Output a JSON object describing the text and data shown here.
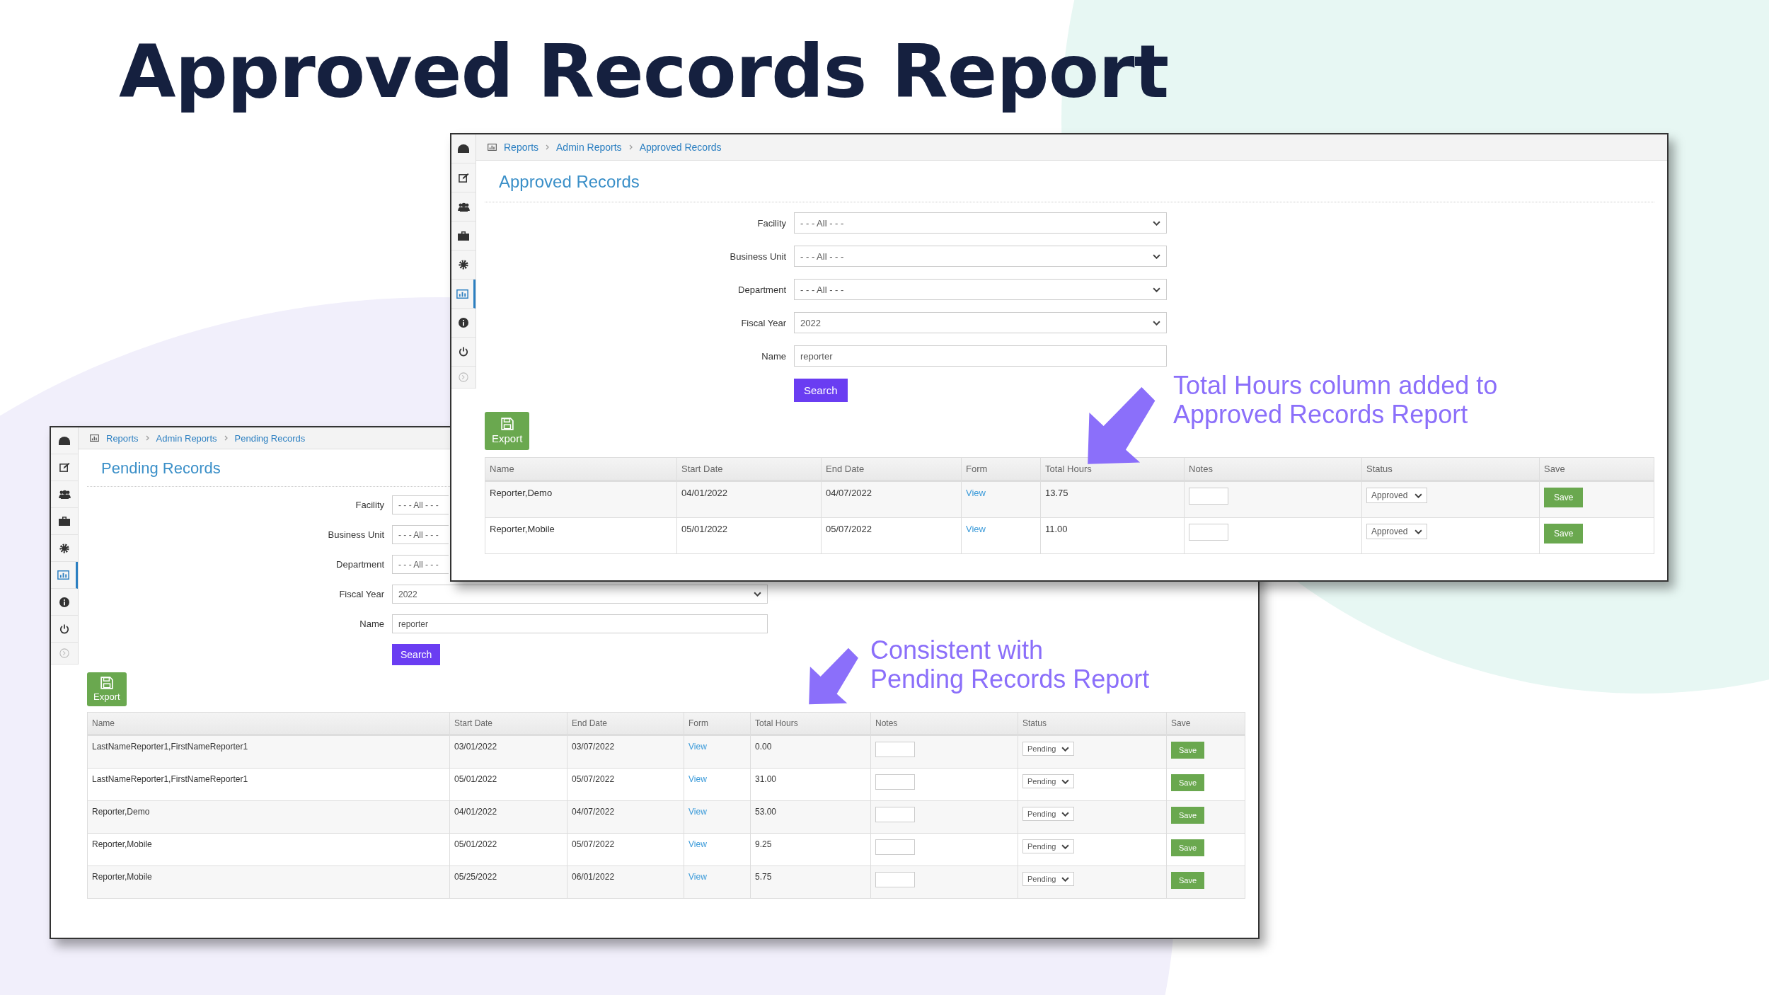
{
  "title": "Approved Records Report",
  "windows": [
    {
      "breadcrumb": [
        "Reports",
        "Admin Reports",
        "Approved Records"
      ],
      "heading": "Approved Records",
      "sidebar": [
        {
          "selected": false
        },
        {
          "selected": false
        },
        {
          "selected": false
        },
        {
          "selected": false
        },
        {
          "selected": false
        },
        {
          "selected": true
        },
        {
          "selected": false
        },
        {
          "selected": false
        },
        {
          "selected": false
        }
      ],
      "filters": [
        {
          "kind": "select",
          "label": "Facility",
          "value": "- - - All - - -"
        },
        {
          "kind": "select",
          "label": "Business Unit",
          "value": "- - - All - - -"
        },
        {
          "kind": "select",
          "label": "Department",
          "value": "- - - All - - -"
        },
        {
          "kind": "select",
          "label": "Fiscal Year",
          "value": "2022"
        },
        {
          "kind": "text",
          "label": "Name",
          "value": "reporter"
        }
      ],
      "search_button": "Search",
      "export_button": "Export",
      "columns": [
        "Name",
        "Start Date",
        "End Date",
        "Form",
        "Total Hours",
        "Notes",
        "Status",
        "Save"
      ],
      "rows": [
        {
          "name": "Reporter,Demo",
          "start": "04/01/2022",
          "end": "04/07/2022",
          "form": "View",
          "total_hours": "13.75",
          "status": "Approved",
          "save": "Save"
        },
        {
          "name": "Reporter,Mobile",
          "start": "05/01/2022",
          "end": "05/07/2022",
          "form": "View",
          "total_hours": "11.00",
          "status": "Approved",
          "save": "Save"
        }
      ]
    },
    {
      "breadcrumb": [
        "Reports",
        "Admin Reports",
        "Pending Records"
      ],
      "heading": "Pending Records",
      "sidebar": [
        {
          "selected": false
        },
        {
          "selected": false
        },
        {
          "selected": false
        },
        {
          "selected": false
        },
        {
          "selected": false
        },
        {
          "selected": true
        },
        {
          "selected": false
        },
        {
          "selected": false
        },
        {
          "selected": false
        }
      ],
      "filters": [
        {
          "kind": "select",
          "label": "Facility",
          "value": "- - - All - - -"
        },
        {
          "kind": "select",
          "label": "Business Unit",
          "value": "- - - All - - -"
        },
        {
          "kind": "select",
          "label": "Department",
          "value": "- - - All - - -"
        },
        {
          "kind": "select",
          "label": "Fiscal Year",
          "value": "2022"
        },
        {
          "kind": "text",
          "label": "Name",
          "value": "reporter"
        }
      ],
      "search_button": "Search",
      "export_button": "Export",
      "columns": [
        "Name",
        "Start Date",
        "End Date",
        "Form",
        "Total Hours",
        "Notes",
        "Status",
        "Save"
      ],
      "rows": [
        {
          "name": "LastNameReporter1,FirstNameReporter1",
          "start": "03/01/2022",
          "end": "03/07/2022",
          "form": "View",
          "total_hours": "0.00",
          "status": "Pending",
          "save": "Save"
        },
        {
          "name": "LastNameReporter1,FirstNameReporter1",
          "start": "05/01/2022",
          "end": "05/07/2022",
          "form": "View",
          "total_hours": "31.00",
          "status": "Pending",
          "save": "Save"
        },
        {
          "name": "Reporter,Demo",
          "start": "04/01/2022",
          "end": "04/07/2022",
          "form": "View",
          "total_hours": "53.00",
          "status": "Pending",
          "save": "Save"
        },
        {
          "name": "Reporter,Mobile",
          "start": "05/01/2022",
          "end": "05/07/2022",
          "form": "View",
          "total_hours": "9.25",
          "status": "Pending",
          "save": "Save"
        },
        {
          "name": "Reporter,Mobile",
          "start": "05/25/2022",
          "end": "06/01/2022",
          "form": "View",
          "total_hours": "5.75",
          "status": "Pending",
          "save": "Save"
        }
      ]
    }
  ],
  "annotations": [
    {
      "lines": [
        "Total Hours column added to",
        "Approved Records Report"
      ]
    },
    {
      "lines": [
        "Consistent with",
        "Pending Records Report"
      ]
    }
  ]
}
